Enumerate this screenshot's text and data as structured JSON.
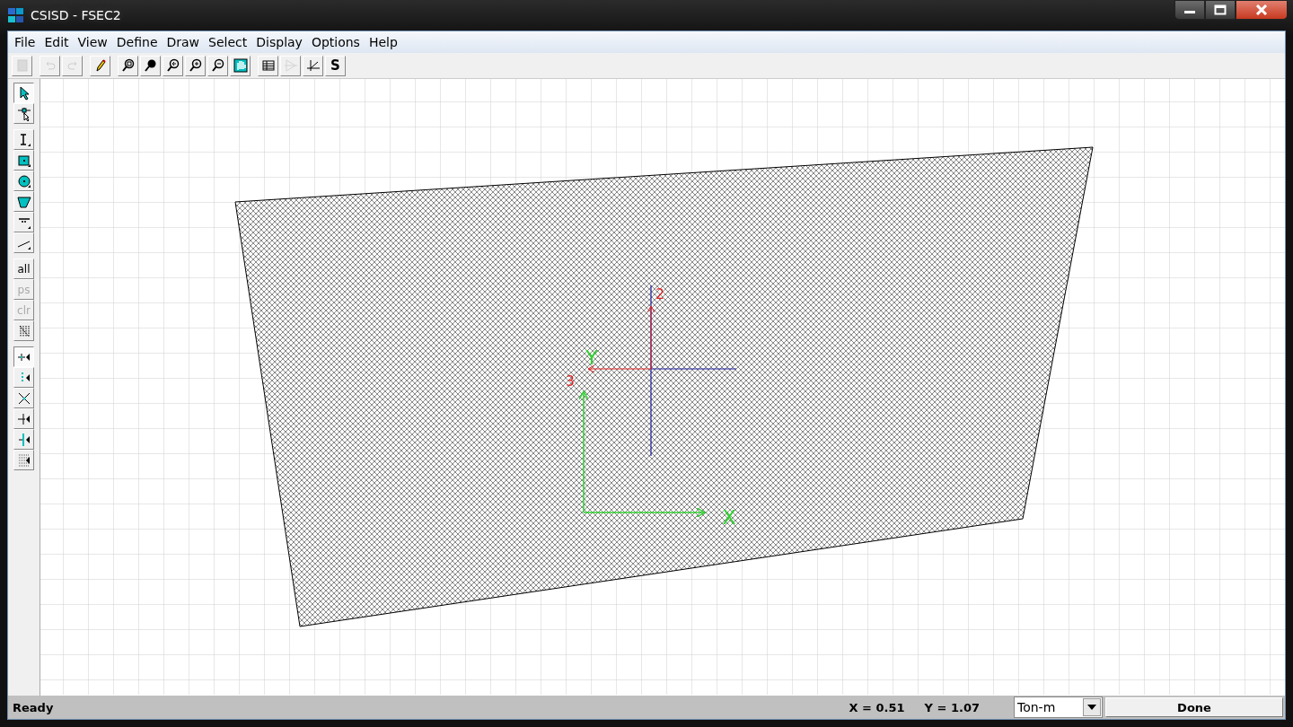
{
  "window": {
    "title": "CSISD - FSEC2"
  },
  "menu": [
    "File",
    "Edit",
    "View",
    "Define",
    "Draw",
    "Select",
    "Display",
    "Options",
    "Help"
  ],
  "toolbar": {
    "groups": [
      [
        {
          "kind": "new",
          "disabled": true
        }
      ],
      [
        {
          "kind": "undo",
          "disabled": true
        },
        {
          "kind": "redo",
          "disabled": true
        }
      ],
      [
        {
          "kind": "pencil",
          "disabled": false
        }
      ],
      [
        {
          "kind": "zoom-window",
          "disabled": false
        },
        {
          "kind": "zoom-full",
          "disabled": false
        },
        {
          "kind": "zoom-previous",
          "disabled": false
        },
        {
          "kind": "zoom-in",
          "disabled": false
        },
        {
          "kind": "zoom-out",
          "disabled": false
        },
        {
          "kind": "pan",
          "disabled": false
        }
      ],
      [
        {
          "kind": "table",
          "disabled": false
        },
        {
          "kind": "triangle",
          "disabled": true
        },
        {
          "kind": "angle",
          "disabled": false
        },
        {
          "kind": "text",
          "label": "S",
          "disabled": false
        }
      ]
    ]
  },
  "tools": {
    "groups": [
      [
        {
          "kind": "pointer",
          "selected": true,
          "disabled": false
        },
        {
          "kind": "node-pointer",
          "selected": false,
          "disabled": false
        }
      ],
      [
        {
          "kind": "dimension",
          "selected": false,
          "disabled": false
        },
        {
          "kind": "rectangle",
          "selected": false,
          "disabled": false
        },
        {
          "kind": "circle",
          "selected": false,
          "disabled": false
        },
        {
          "kind": "polygon",
          "selected": false,
          "disabled": false
        },
        {
          "kind": "rebar-line",
          "selected": false,
          "disabled": false
        },
        {
          "kind": "line",
          "selected": false,
          "disabled": false
        }
      ],
      [
        {
          "kind": "text",
          "label": "all",
          "selected": false,
          "disabled": false
        },
        {
          "kind": "text",
          "label": "ps",
          "selected": false,
          "disabled": true
        },
        {
          "kind": "text",
          "label": "clr",
          "selected": false,
          "disabled": true
        },
        {
          "kind": "hatch",
          "selected": false,
          "disabled": false
        }
      ],
      [
        {
          "kind": "snap-point",
          "selected": true,
          "disabled": false
        },
        {
          "kind": "snap-end",
          "selected": false,
          "disabled": false
        },
        {
          "kind": "snap-intersection",
          "selected": false,
          "disabled": false
        },
        {
          "kind": "snap-perpendicular",
          "selected": false,
          "disabled": false
        },
        {
          "kind": "snap-line",
          "selected": false,
          "disabled": false
        },
        {
          "kind": "snap-grid",
          "selected": false,
          "disabled": false
        }
      ]
    ]
  },
  "canvas": {
    "local_axis_labels": [
      "2",
      "3"
    ],
    "global_axis_labels": [
      "Y",
      "X"
    ]
  },
  "status_bar": {
    "message": "Ready",
    "x_reading": "X = 0.51",
    "y_reading": "Y = 1.07",
    "units": "Ton-m",
    "done_button": "Done"
  }
}
